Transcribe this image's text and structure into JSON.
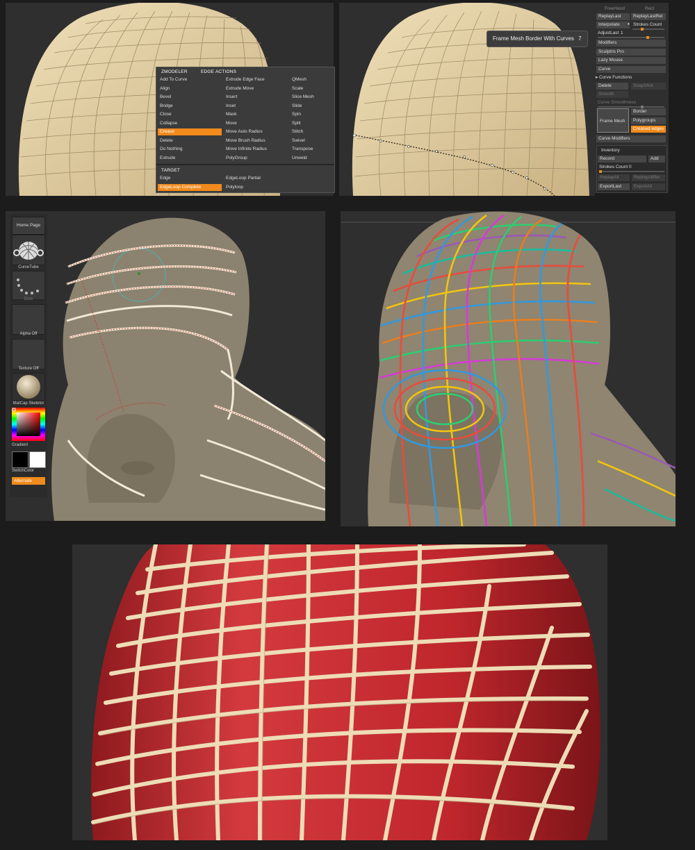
{
  "zmodeler_menu": {
    "header_left": "ZMODELER",
    "header_right": "EDGE ACTIONS",
    "col1": [
      "Add To Curve",
      "Align",
      "Bevel",
      "Bridge",
      "Close",
      "Collapse",
      "Crease",
      "Delete",
      "Do Nothing",
      "Extrude"
    ],
    "col2": [
      "Extrude Edge Face",
      "Extrude Move",
      "Insert",
      "Inset",
      "Mask",
      "Move",
      "Move Auto Radius",
      "Move Brush Radius",
      "Move Infinite Radius",
      "PolyGroup"
    ],
    "col3": [
      "QMesh",
      "Scale",
      "Slice Mesh",
      "Slide",
      "Spin",
      "Split",
      "Stitch",
      "Swivel",
      "Transpose",
      "Unweld"
    ],
    "selected_action": "Crease",
    "target_header": "TARGET",
    "target_col1": [
      "Edge",
      "EdgeLoop Complete"
    ],
    "target_col2": [
      "EdgeLoop Partial",
      "Polyloop"
    ],
    "selected_target": "EdgeLoop Complete"
  },
  "tooltip": {
    "text": "Frame Mesh Border With Curves",
    "count": "7"
  },
  "stroke_palette": {
    "top_left": "FreeHand",
    "top_right": "Rect",
    "replay_last": "ReplayLast",
    "replay_last_rel": "ReplayLastRel",
    "interpolate": "Interpolate",
    "strokes_count": "Strokes Count",
    "adjust_last": "AdjustLast",
    "adjust_last_value": "1",
    "modifiers": "Modifiers",
    "sculptris_pro": "Sculptris Pro",
    "lazy_mouse": "Lazy Mouse",
    "curve": "Curve",
    "curve_functions": "Curve Functions",
    "delete": "Delete",
    "snapshot": "SnapShot",
    "smooth": "Smooth",
    "curve_smoothness": "Curve Smoothness",
    "frame_mesh": "Frame Mesh",
    "border": "Border",
    "polygroups": "Polygroups",
    "creased_edges": "Creased edges",
    "curve_modifiers": "Curve Modifiers",
    "inventory": "Inventory",
    "record": "Record",
    "add": "Add",
    "inventory_strokes_count": "Strokes Count",
    "inventory_strokes_value": "0",
    "replay_all": "ReplayAll",
    "replay_all_rel": "ReplayAllRel",
    "export_last": "ExportLast",
    "export_all": "ExportAll"
  },
  "left_shelf": {
    "home_page": "Home Page",
    "brush": "CurveTube",
    "stroke": "Dots",
    "alpha": "Alpha Off",
    "texture": "Texture Off",
    "material": "MatCap Skeletor",
    "gradient": "Gradient",
    "switch_color": "SwitchColor",
    "alternate": "Alternate"
  },
  "colors": {
    "accent": "#f08a1c",
    "clay": "#8c8270",
    "mesh_skin": "#e6d3a8",
    "tube": "#e8d9b8",
    "red_mesh": "#c0272d"
  }
}
